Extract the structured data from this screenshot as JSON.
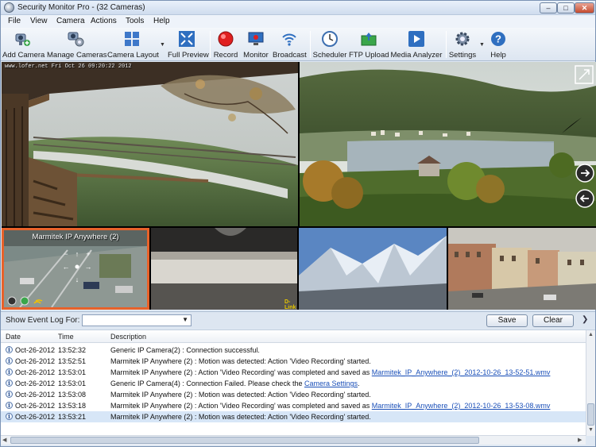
{
  "window": {
    "title": "Security Monitor Pro - (32 Cameras)"
  },
  "menu": [
    "File",
    "View",
    "Camera",
    "Actions",
    "Tools",
    "Help"
  ],
  "toolbar": {
    "buttons": [
      "Add Camera",
      "Manage Cameras",
      "Camera Layout",
      "Full Preview",
      "Record",
      "Monitor",
      "Broadcast",
      "Scheduler",
      "FTP Upload",
      "Media Analyzer",
      "Settings",
      "Help"
    ]
  },
  "cameras": {
    "cam1_overlay": "www.lofer.net  Fri Oct 26  09:20:22  2012",
    "selected_label": "Marmitek IP Anywhere (2)",
    "dlink_overlay": "D-Link"
  },
  "event_log": {
    "label": "Show Event Log For:",
    "filter_value": "",
    "save_label": "Save",
    "clear_label": "Clear",
    "columns": [
      "Date",
      "Time",
      "Description"
    ],
    "rows": [
      {
        "date": "Oct-26-2012",
        "time": "13:52:32",
        "desc": "Generic IP Camera(2) : Connection successful.",
        "link": ""
      },
      {
        "date": "Oct-26-2012",
        "time": "13:52:51",
        "desc": "Marmitek IP Anywhere (2) : Motion was detected: Action 'Video Recording' started.",
        "link": ""
      },
      {
        "date": "Oct-26-2012",
        "time": "13:53:01",
        "desc": "Marmitek IP Anywhere (2) : Action 'Video Recording' was completed and saved as ",
        "link": "Marmitek_IP_Anywhere_(2)_2012-10-26_13-52-51.wmv"
      },
      {
        "date": "Oct-26-2012",
        "time": "13:53:01",
        "desc": "Generic IP Camera(4) : Connection Failed. Please check the ",
        "link": "Camera Settings"
      },
      {
        "date": "Oct-26-2012",
        "time": "13:53:08",
        "desc": "Marmitek IP Anywhere (2) : Motion was detected: Action 'Video Recording' started.",
        "link": ""
      },
      {
        "date": "Oct-26-2012",
        "time": "13:53:18",
        "desc": "Marmitek IP Anywhere (2) : Action 'Video Recording' was completed and saved as ",
        "link": "Marmitek_IP_Anywhere_(2)_2012-10-26_13-53-08.wmv"
      },
      {
        "date": "Oct-26-2012",
        "time": "13:53:21",
        "desc": "Marmitek IP Anywhere (2) : Motion was detected: Action 'Video Recording' started.",
        "link": ""
      }
    ]
  },
  "colors": {
    "selection_border": "#e8622a",
    "link": "#1a4fb8",
    "accent": "#2f6fc0"
  }
}
